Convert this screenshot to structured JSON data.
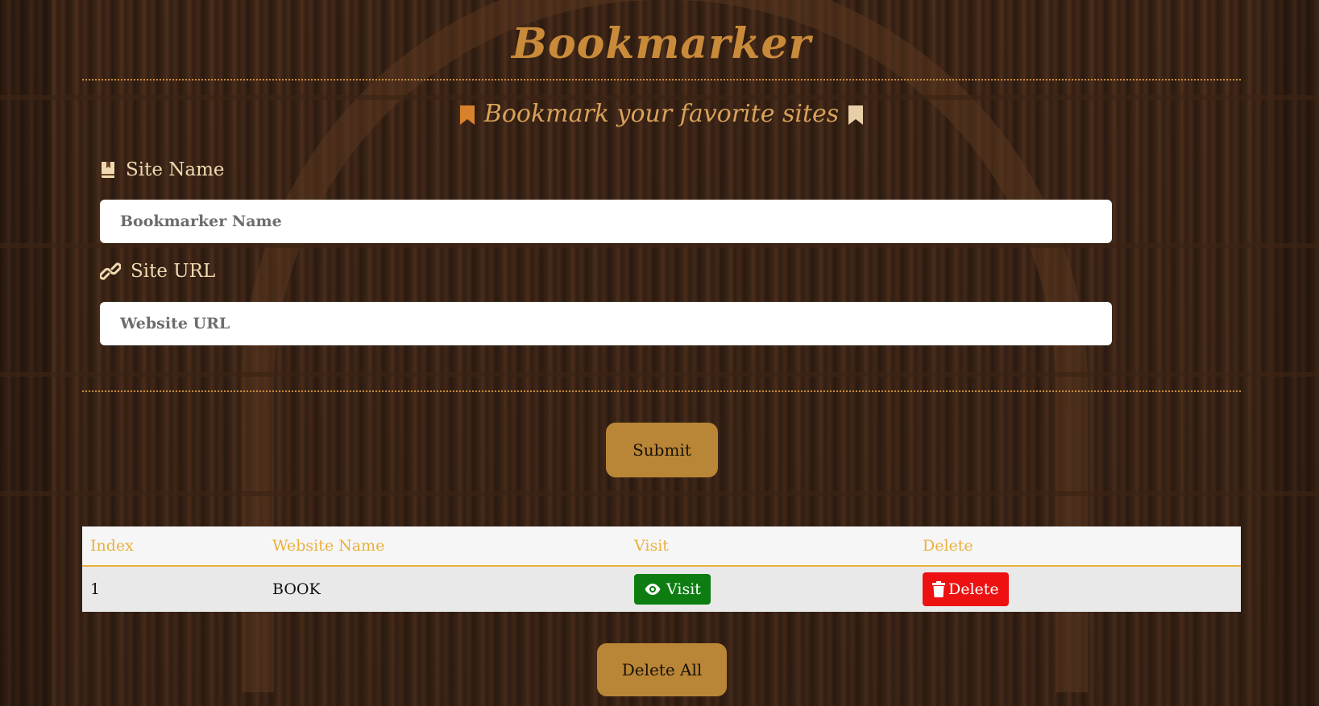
{
  "app": {
    "title": "Bookmarker",
    "subtitle": "Bookmark your favorite sites"
  },
  "form": {
    "site_name_label": "Site Name",
    "site_name_placeholder": "Bookmarker Name",
    "site_name_value": "",
    "site_url_label": "Site URL",
    "site_url_placeholder": "Website URL",
    "site_url_value": "",
    "submit_label": "Submit"
  },
  "table": {
    "headers": [
      "Index",
      "Website Name",
      "Visit",
      "Delete"
    ],
    "rows": [
      {
        "index": "1",
        "website_name": "BOOK",
        "visit_label": "Visit",
        "delete_label": "Delete"
      }
    ]
  },
  "footer": {
    "delete_all_label": "Delete All"
  },
  "colors": {
    "accent_gold": "#c98a3a",
    "header_text": "#e8b13a",
    "button_gold": "#b98536",
    "visit_green": "#0d7d11",
    "delete_red": "#ee1111"
  },
  "icons": {
    "subtitle_left": "bookmark-icon",
    "subtitle_right": "bookmark-icon",
    "site_name": "book-bookmark-icon",
    "site_url": "link-icon",
    "visit": "eye-icon",
    "delete": "trash-icon"
  }
}
